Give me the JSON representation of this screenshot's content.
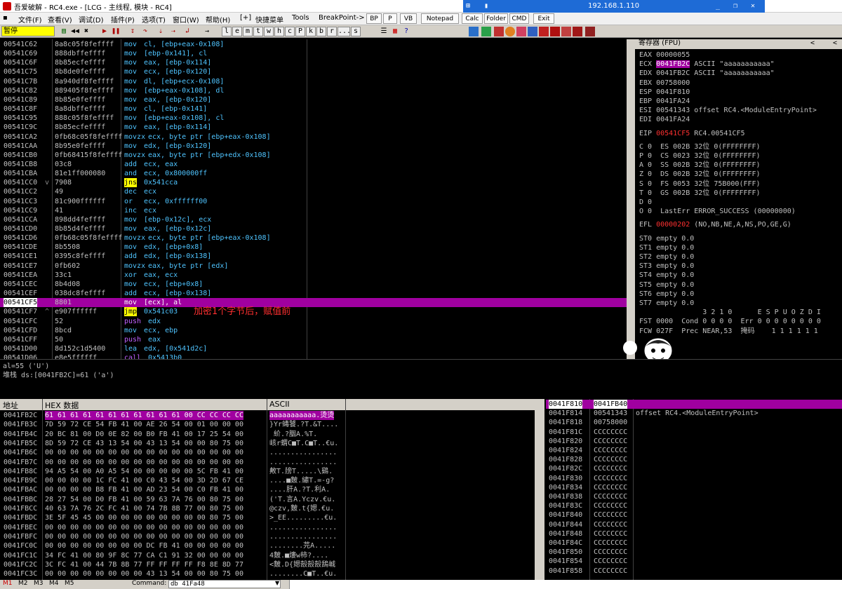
{
  "window": {
    "title": "吾爱破解 - RC4.exe - [LCG - 主线程, 模块 - RC4]",
    "remote_ip": "192.168.1.110",
    "colors": {
      "menu_bg": "#f0f0f0",
      "highlight": "#a000a0",
      "accent": "#ff3030",
      "mnemonic": "#4fc4ff"
    }
  },
  "menu": {
    "items": [
      "文件(F)",
      "查看(V)",
      "调试(D)",
      "插件(P)",
      "选项(T)",
      "窗口(W)",
      "帮助(H)",
      "[+]",
      "快捷菜单",
      "Tools",
      "BreakPoint->"
    ],
    "buttons": [
      "BP",
      "P",
      "VB",
      "Notepad",
      "Calc",
      "Folder",
      "CMD",
      "Exit"
    ]
  },
  "toolbar": {
    "status": "暂停",
    "letters": [
      "l",
      "e",
      "m",
      "t",
      "w",
      "h",
      "c",
      "P",
      "k",
      "b",
      "r",
      "...",
      "s"
    ]
  },
  "disasm": {
    "rows": [
      {
        "addr": "00541C62",
        "hex": "8a8c05f8feffff",
        "mn": "mov",
        "ops": "cl, [ebp+eax-0x108]"
      },
      {
        "addr": "00541C69",
        "hex": "888dbffeffff",
        "mn": "mov",
        "ops": "[ebp-0x141], cl"
      },
      {
        "addr": "00541C6F",
        "hex": "8b85ecfeffff",
        "mn": "mov",
        "ops": "eax, [ebp-0x114]"
      },
      {
        "addr": "00541C75",
        "hex": "8b8de0feffff",
        "mn": "mov",
        "ops": "ecx, [ebp-0x120]"
      },
      {
        "addr": "00541C7B",
        "hex": "8a940df8feffff",
        "mn": "mov",
        "ops": "dl, [ebp+ecx-0x108]"
      },
      {
        "addr": "00541C82",
        "hex": "889405f8feffff",
        "mn": "mov",
        "ops": "[ebp+eax-0x108], dl"
      },
      {
        "addr": "00541C89",
        "hex": "8b85e0feffff",
        "mn": "mov",
        "ops": "eax, [ebp-0x120]"
      },
      {
        "addr": "00541C8F",
        "hex": "8a8dbffeffff",
        "mn": "mov",
        "ops": "cl, [ebp-0x141]"
      },
      {
        "addr": "00541C95",
        "hex": "888c05f8feffff",
        "mn": "mov",
        "ops": "[ebp+eax-0x108], cl"
      },
      {
        "addr": "00541C9C",
        "hex": "8b85ecfeffff",
        "mn": "mov",
        "ops": "eax, [ebp-0x114]"
      },
      {
        "addr": "00541CA2",
        "hex": "0fb68c05f8feffff",
        "mn": "movzx",
        "ops": "ecx, byte ptr [ebp+eax-0x108]"
      },
      {
        "addr": "00541CAA",
        "hex": "8b95e0feffff",
        "mn": "mov",
        "ops": "edx, [ebp-0x120]"
      },
      {
        "addr": "00541CB0",
        "hex": "0fb68415f8feffff",
        "mn": "movzx",
        "ops": "eax, byte ptr [ebp+edx-0x108]"
      },
      {
        "addr": "00541CB8",
        "hex": "03c8",
        "mn": "add",
        "ops": "ecx, eax"
      },
      {
        "addr": "00541CBA",
        "hex": "81e1ff000080",
        "mn": "and",
        "ops": "ecx, 0x800000ff"
      },
      {
        "addr": "00541CC0",
        "hex": "7908",
        "mn": "jns",
        "ops": "0x541cca",
        "mark": "v"
      },
      {
        "addr": "00541CC2",
        "hex": "49",
        "mn": "dec",
        "ops": "ecx"
      },
      {
        "addr": "00541CC3",
        "hex": "81c900ffffff",
        "mn": "or",
        "ops": "ecx, 0xffffff00"
      },
      {
        "addr": "00541CC9",
        "hex": "41",
        "mn": "inc",
        "ops": "ecx"
      },
      {
        "addr": "00541CCA",
        "hex": "898dd4feffff",
        "mn": "mov",
        "ops": "[ebp-0x12c], ecx"
      },
      {
        "addr": "00541CD0",
        "hex": "8b85d4feffff",
        "mn": "mov",
        "ops": "eax, [ebp-0x12c]"
      },
      {
        "addr": "00541CD6",
        "hex": "0fb68c05f8feffff",
        "mn": "movzx",
        "ops": "ecx, byte ptr [ebp+eax-0x108]"
      },
      {
        "addr": "00541CDE",
        "hex": "8b5508",
        "mn": "mov",
        "ops": "edx, [ebp+0x8]"
      },
      {
        "addr": "00541CE1",
        "hex": "0395c8feffff",
        "mn": "add",
        "ops": "edx, [ebp-0x138]"
      },
      {
        "addr": "00541CE7",
        "hex": "0fb602",
        "mn": "movzx",
        "ops": "eax, byte ptr [edx]"
      },
      {
        "addr": "00541CEA",
        "hex": "33c1",
        "mn": "xor",
        "ops": "eax, ecx"
      },
      {
        "addr": "00541CEC",
        "hex": "8b4d08",
        "mn": "mov",
        "ops": "ecx, [ebp+0x8]"
      },
      {
        "addr": "00541CEF",
        "hex": "038dc8feffff",
        "mn": "add",
        "ops": "ecx, [ebp-0x138]"
      },
      {
        "addr": "00541CF5",
        "hex": "8801",
        "mn": "mov",
        "ops": "[ecx], al",
        "current": true
      },
      {
        "addr": "00541CF7",
        "hex": "e907ffffff",
        "mn": "jmp",
        "ops": "0x541c03",
        "mark": "^",
        "comment": "加密1个字节后，赋值前"
      },
      {
        "addr": "00541CFC",
        "hex": "52",
        "mn": "push",
        "ops": "edx"
      },
      {
        "addr": "00541CFD",
        "hex": "8bcd",
        "mn": "mov",
        "ops": "ecx, ebp"
      },
      {
        "addr": "00541CFF",
        "hex": "50",
        "mn": "push",
        "ops": "eax"
      },
      {
        "addr": "00541D00",
        "hex": "8d152c1d5400",
        "mn": "lea",
        "ops": "edx, [0x541d2c]"
      },
      {
        "addr": "00541D06",
        "hex": "e8e5ffffff",
        "mn": "call",
        "ops": "0x5413b0"
      }
    ]
  },
  "info": {
    "line1": "al=55 ('U')",
    "line2": "堆栈 ds:[0041FB2C]=61 ('a')"
  },
  "registers": {
    "title": "寄存器 (FPU)",
    "general": [
      {
        "name": "EAX",
        "value": "00000055",
        "note": ""
      },
      {
        "name": "ECX",
        "value": "0041FB2C",
        "note": "ASCII \"aaaaaaaaaaa\"",
        "hl": true
      },
      {
        "name": "EDX",
        "value": "0041FB2C",
        "note": "ASCII \"aaaaaaaaaaa\""
      },
      {
        "name": "EBX",
        "value": "00758000",
        "note": ""
      },
      {
        "name": "ESP",
        "value": "0041F810",
        "note": ""
      },
      {
        "name": "EBP",
        "value": "0041FA24",
        "note": ""
      },
      {
        "name": "ESI",
        "value": "00541343",
        "note": "offset RC4.<ModuleEntryPoint>"
      },
      {
        "name": "EDI",
        "value": "0041FA24",
        "note": ""
      }
    ],
    "eip": {
      "name": "EIP",
      "value": "00541CF5",
      "note": "RC4.00541CF5"
    },
    "flags": [
      "C 0  ES 002B 32位 0(FFFFFFFF)",
      "P 0  CS 0023 32位 0(FFFFFFFF)",
      "A 0  SS 002B 32位 0(FFFFFFFF)",
      "Z 0  DS 002B 32位 0(FFFFFFFF)",
      "S 0  FS 0053 32位 75B000(FFF)",
      "T 0  GS 002B 32位 0(FFFFFFFF)",
      "D 0",
      "O 0  LastErr ERROR_SUCCESS (00000000)"
    ],
    "efl": {
      "name": "EFL",
      "value": "00000202",
      "note": "(NO,NB,NE,A,NS,PO,GE,G)"
    },
    "st": [
      "ST0 empty 0.0",
      "ST1 empty 0.0",
      "ST2 empty 0.0",
      "ST3 empty 0.0",
      "ST4 empty 0.0",
      "ST5 empty 0.0",
      "ST6 empty 0.0",
      "ST7 empty 0.0"
    ],
    "fpu_hdr": "               3 2 1 0      E S P U O Z D I",
    "fst": "FST 0000  Cond 0 0 0 0  Err 0 0 0 0 0 0 0 0",
    "fcw": "FCW 027F  Prec NEAR,53  掩码    1 1 1 1 1 1"
  },
  "dump": {
    "headers": {
      "addr": "地址",
      "hex": "HEX 数据",
      "ascii": "ASCII"
    },
    "rows": [
      {
        "addr": "0041FB2C",
        "hex": "61 61 61 61 61 61 61 61 61 61 61 00 CC CC CC CC",
        "ascii": "aaaaaaaaaaa.烫烫",
        "hl": true
      },
      {
        "addr": "0041FB3C",
        "hex": "7D 59 72 CE 54 FB 41 00 AE 26 54 00 01 00 00 00",
        "ascii": "}Yr蝳饕.?T.&T...."
      },
      {
        "addr": "0041FB4C",
        "hex": "20 BC 81 00 D0 0E 82 00 B0 FB 41 00 17 25 54 00",
        "ascii": " 紒.?胭A.%T."
      },
      {
        "addr": "0041FB5C",
        "hex": "8D 59 72 CE 43 13 54 00 43 13 54 00 00 80 75 00",
        "ascii": "峐r蝟C■T.C■T..€u."
      },
      {
        "addr": "0041FB6C",
        "hex": "00 00 00 00 00 00 00 00 00 00 00 00 00 00 00 00",
        "ascii": "................"
      },
      {
        "addr": "0041FB7C",
        "hex": "00 00 00 00 00 00 00 00 00 00 00 00 00 00 00 00",
        "ascii": "................"
      },
      {
        "addr": "0041FB8C",
        "hex": "94 A5 54 00 A0 A5 54 00 00 00 00 00 5C FB 41 00",
        "ascii": "敟T.牓T.....\\鷄."
      },
      {
        "addr": "0041FB9C",
        "hex": "00 00 00 00 1C FC 41 00 C0 43 54 00 3D 2D 67 CE",
        "ascii": "....■麬.繡T.=-g?"
      },
      {
        "addr": "0041FBAC",
        "hex": "00 00 00 00 B8 FB 41 00 AD 23 54 00 C0 FB 41 00",
        "ascii": "....肝A.?T.利A."
      },
      {
        "addr": "0041FBBC",
        "hex": "28 27 54 00 D0 FB 41 00 59 63 7A 76 00 80 75 00",
        "ascii": "('T.言A.Yczv.€u."
      },
      {
        "addr": "0041FBCC",
        "hex": "40 63 7A 76 2C FC 41 00 74 7B 8B 77 00 80 75 00",
        "ascii": "@czv,麬.t{媤.€u."
      },
      {
        "addr": "0041FBDC",
        "hex": "3E 5F 45 45 00 00 00 00 00 00 00 00 00 80 75 00",
        "ascii": ">_EE.........€u."
      },
      {
        "addr": "0041FBEC",
        "hex": "00 00 00 00 00 00 00 00 00 00 00 00 00 00 00 00",
        "ascii": "................"
      },
      {
        "addr": "0041FBFC",
        "hex": "00 00 00 00 00 00 00 00 00 00 00 00 00 00 00 00",
        "ascii": "................"
      },
      {
        "addr": "0041FC0C",
        "hex": "00 00 00 00 00 00 00 00 DC FB 41 00 00 00 00 00",
        "ascii": "........芫A....."
      },
      {
        "addr": "0041FC1C",
        "hex": "34 FC 41 00 80 9F 8C 77 CA C1 91 32 00 00 00 00",
        "ascii": "4麬.■熡w柿?...."
      },
      {
        "addr": "0041FC2C",
        "hex": "3C FC 41 00 44 7B 8B 77 FF FF FF FF F8 8E 8D 77",
        "ascii": "<麬.D{媤嗀嗀嗀鴰峸"
      },
      {
        "addr": "0041FC3C",
        "hex": "00 00 00 00 00 00 00 00 43 13 54 00 00 80 75 00",
        "ascii": "........C■T..€u."
      }
    ]
  },
  "stack": {
    "rows": [
      {
        "addr": "0041F810",
        "value": "0041FB40",
        "note": "",
        "hl": true
      },
      {
        "addr": "0041F814",
        "value": "00541343",
        "note": "offset RC4.<ModuleEntryPoint>"
      },
      {
        "addr": "0041F818",
        "value": "00758000",
        "note": ""
      },
      {
        "addr": "0041F81C",
        "value": "CCCCCCCC",
        "note": ""
      },
      {
        "addr": "0041F820",
        "value": "CCCCCCCC",
        "note": ""
      },
      {
        "addr": "0041F824",
        "value": "CCCCCCCC",
        "note": ""
      },
      {
        "addr": "0041F828",
        "value": "CCCCCCCC",
        "note": ""
      },
      {
        "addr": "0041F82C",
        "value": "CCCCCCCC",
        "note": ""
      },
      {
        "addr": "0041F830",
        "value": "CCCCCCCC",
        "note": ""
      },
      {
        "addr": "0041F834",
        "value": "CCCCCCCC",
        "note": ""
      },
      {
        "addr": "0041F838",
        "value": "CCCCCCCC",
        "note": ""
      },
      {
        "addr": "0041F83C",
        "value": "CCCCCCCC",
        "note": ""
      },
      {
        "addr": "0041F840",
        "value": "CCCCCCCC",
        "note": ""
      },
      {
        "addr": "0041F844",
        "value": "CCCCCCCC",
        "note": ""
      },
      {
        "addr": "0041F848",
        "value": "CCCCCCCC",
        "note": ""
      },
      {
        "addr": "0041F84C",
        "value": "CCCCCCCC",
        "note": ""
      },
      {
        "addr": "0041F850",
        "value": "CCCCCCCC",
        "note": ""
      },
      {
        "addr": "0041F854",
        "value": "CCCCCCCC",
        "note": ""
      },
      {
        "addr": "0041F858",
        "value": "CCCCCCCC",
        "note": ""
      }
    ]
  },
  "command": {
    "tabs": [
      "M1",
      "M2",
      "M3",
      "M4",
      "M5"
    ],
    "label": "Command:",
    "value": "db 41Fa48"
  }
}
